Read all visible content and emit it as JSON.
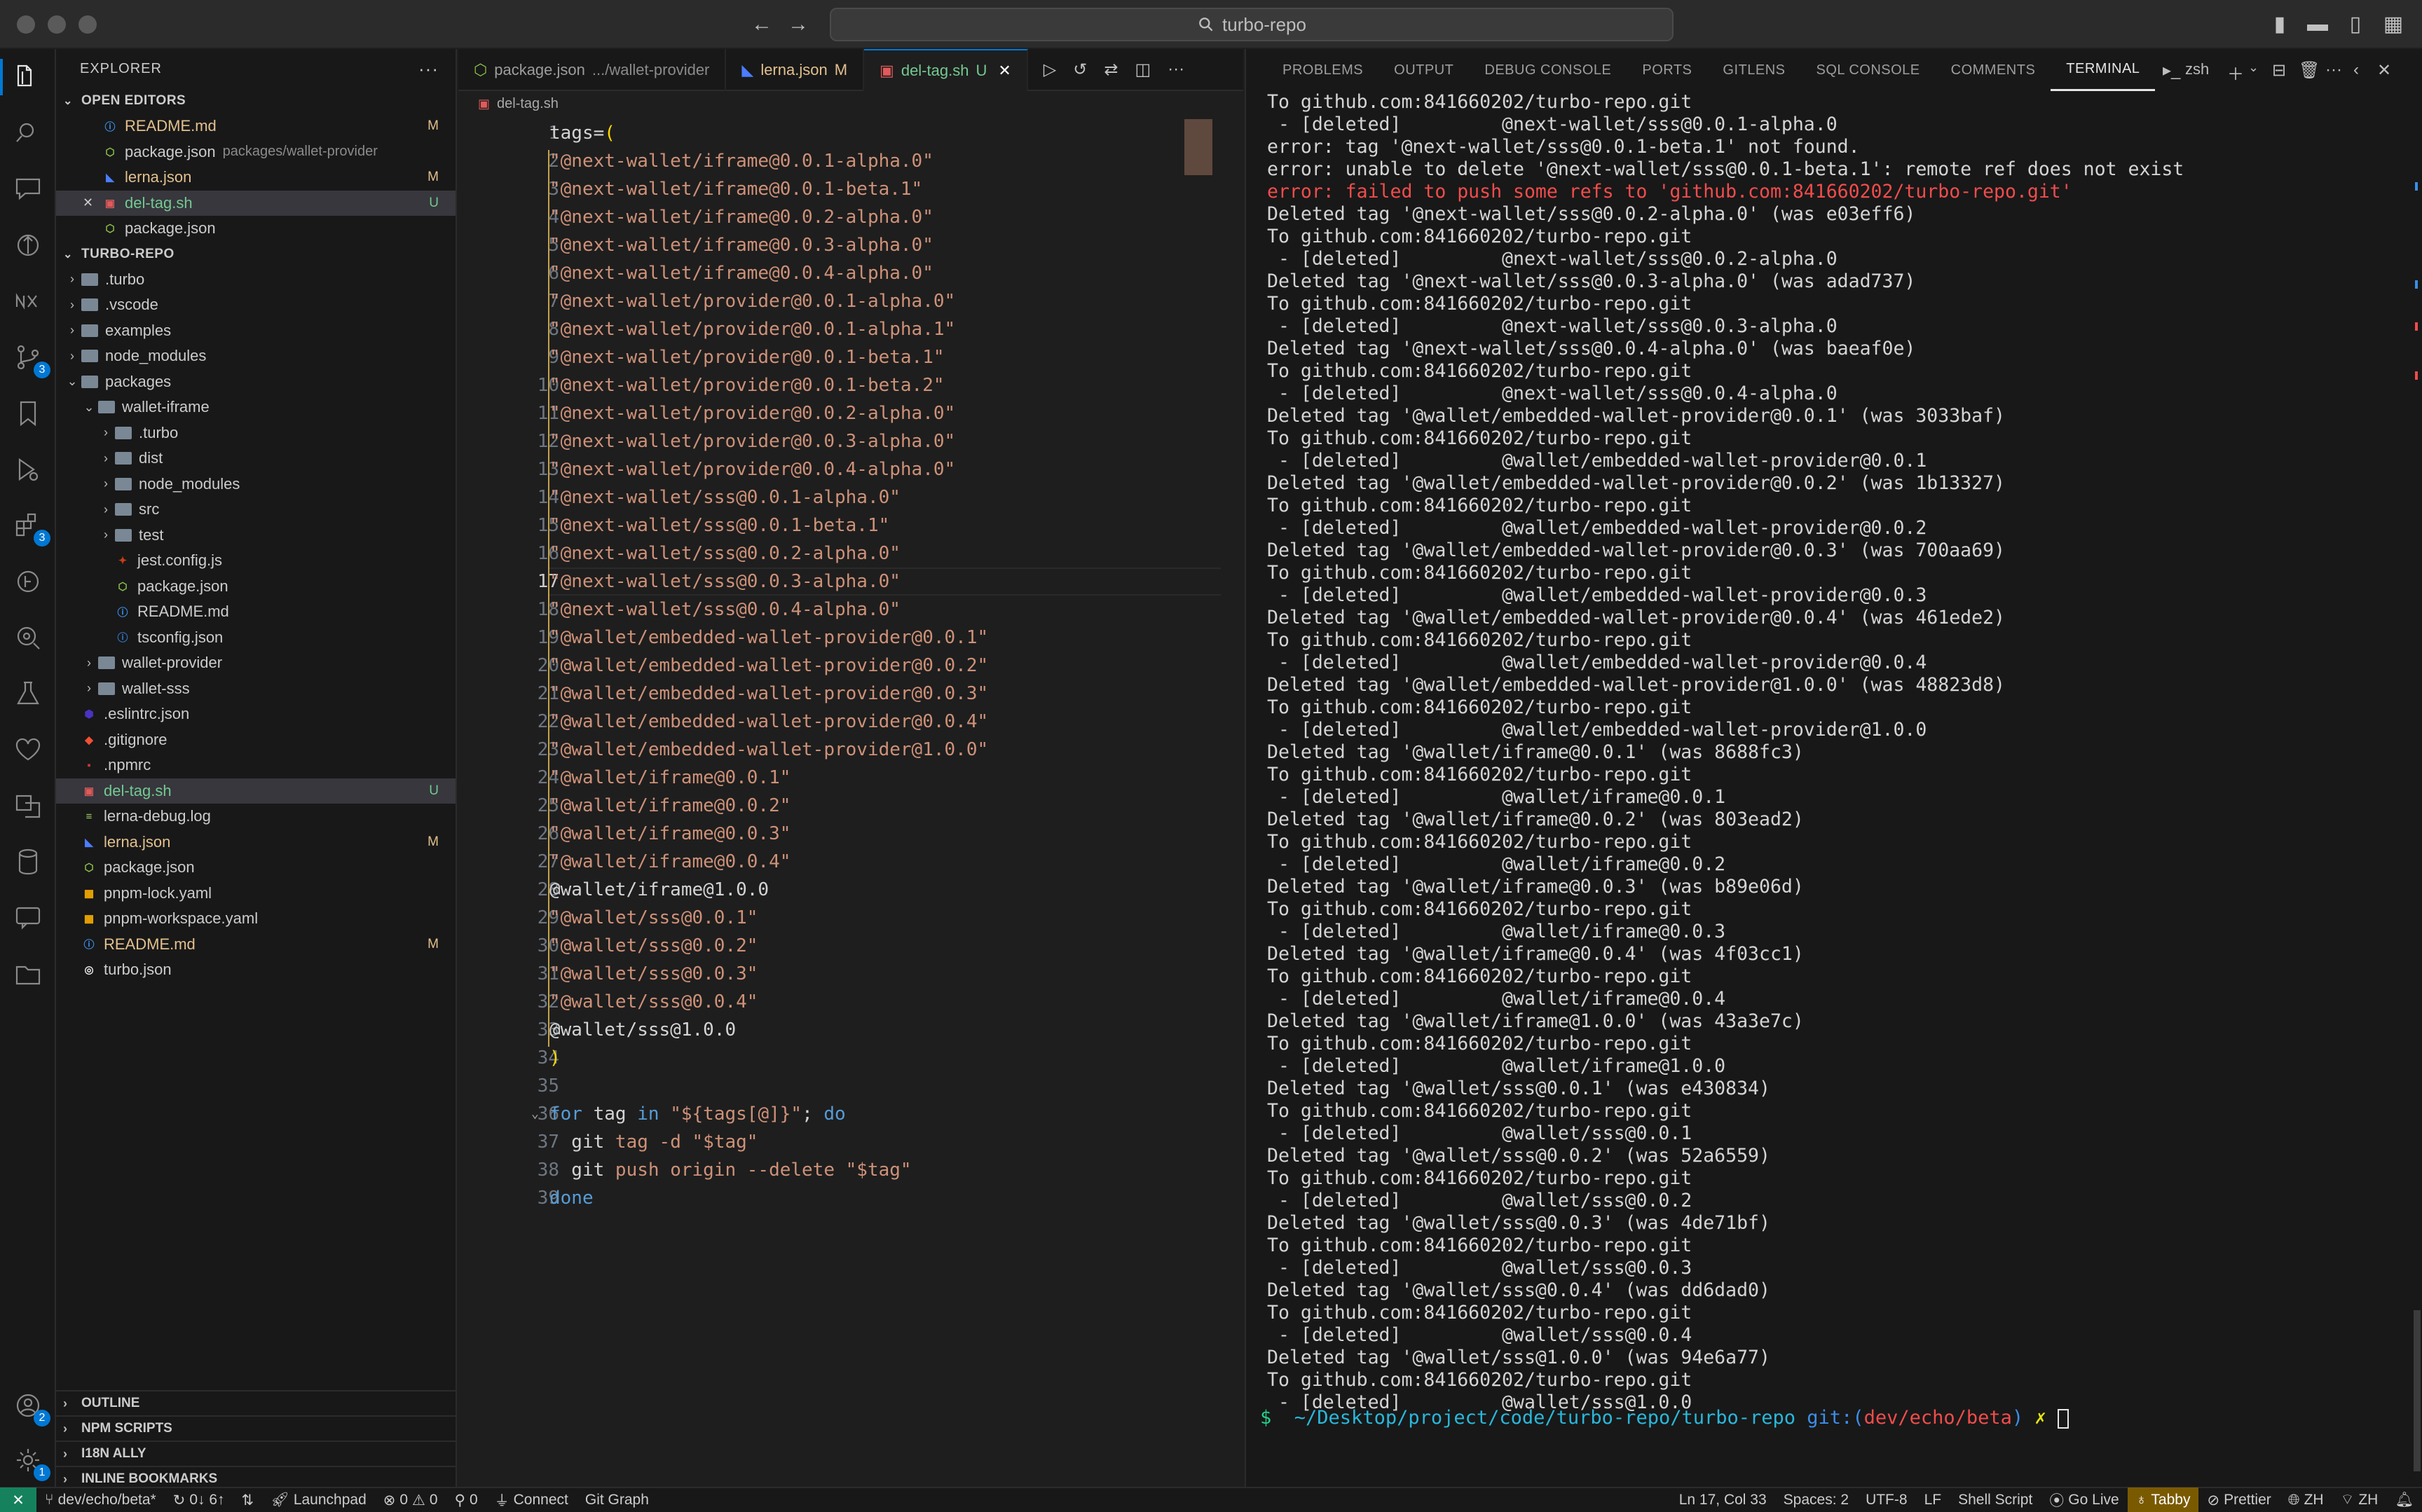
{
  "window": {
    "search_text": "turbo-repo"
  },
  "activity_bar": {
    "items": [
      {
        "name": "explorer"
      },
      {
        "name": "search"
      },
      {
        "name": "chat"
      },
      {
        "name": "gitlens"
      },
      {
        "name": "nx"
      },
      {
        "name": "source-control",
        "badge": "3"
      },
      {
        "name": "bookmarks"
      },
      {
        "name": "run-debug"
      },
      {
        "name": "extensions",
        "badge": "3"
      },
      {
        "name": "git-graph"
      },
      {
        "name": "remote"
      },
      {
        "name": "testing"
      },
      {
        "name": "favorites"
      },
      {
        "name": "i18n"
      },
      {
        "name": "database"
      },
      {
        "name": "comments"
      },
      {
        "name": "folder"
      }
    ],
    "accounts_badge": "2",
    "settings_badge": "1"
  },
  "sidebar": {
    "title": "EXPLORER",
    "open_editors_title": "OPEN EDITORS",
    "open_editors": [
      {
        "name": "README.md",
        "desc": "",
        "status": "M",
        "icon": "info"
      },
      {
        "name": "package.json",
        "desc": "packages/wallet-provider",
        "status": "",
        "icon": "json"
      },
      {
        "name": "lerna.json",
        "desc": "",
        "status": "M",
        "icon": "lerna"
      },
      {
        "name": "del-tag.sh",
        "desc": "",
        "status": "U",
        "icon": "shell"
      },
      {
        "name": "package.json",
        "desc": "",
        "status": "",
        "icon": "json"
      }
    ],
    "repo_title": "TURBO-REPO",
    "tree": [
      {
        "name": ".turbo",
        "type": "folder",
        "depth": 1,
        "open": false,
        "status": ""
      },
      {
        "name": ".vscode",
        "type": "folder",
        "depth": 1,
        "open": false,
        "status": ""
      },
      {
        "name": "examples",
        "type": "folder",
        "depth": 1,
        "open": false,
        "status": ""
      },
      {
        "name": "node_modules",
        "type": "folder",
        "depth": 1,
        "open": false,
        "status": ""
      },
      {
        "name": "packages",
        "type": "folder",
        "depth": 1,
        "open": true,
        "status": ""
      },
      {
        "name": "wallet-iframe",
        "type": "folder",
        "depth": 2,
        "open": true,
        "status": ""
      },
      {
        "name": ".turbo",
        "type": "folder",
        "depth": 3,
        "open": false,
        "status": ""
      },
      {
        "name": "dist",
        "type": "folder",
        "depth": 3,
        "open": false,
        "status": ""
      },
      {
        "name": "node_modules",
        "type": "folder",
        "depth": 3,
        "open": false,
        "status": ""
      },
      {
        "name": "src",
        "type": "folder",
        "depth": 3,
        "open": false,
        "status": ""
      },
      {
        "name": "test",
        "type": "folder",
        "depth": 3,
        "open": false,
        "status": ""
      },
      {
        "name": "jest.config.js",
        "type": "file",
        "depth": 3,
        "icon": "jest",
        "status": ""
      },
      {
        "name": "package.json",
        "type": "file",
        "depth": 3,
        "icon": "json",
        "status": ""
      },
      {
        "name": "README.md",
        "type": "file",
        "depth": 3,
        "icon": "info",
        "status": ""
      },
      {
        "name": "tsconfig.json",
        "type": "file",
        "depth": 3,
        "icon": "ts",
        "status": ""
      },
      {
        "name": "wallet-provider",
        "type": "folder",
        "depth": 2,
        "open": false,
        "status": ""
      },
      {
        "name": "wallet-sss",
        "type": "folder",
        "depth": 2,
        "open": false,
        "status": ""
      },
      {
        "name": ".eslintrc.json",
        "type": "file",
        "depth": 1,
        "icon": "eslint",
        "status": ""
      },
      {
        "name": ".gitignore",
        "type": "file",
        "depth": 1,
        "icon": "git",
        "status": ""
      },
      {
        "name": ".npmrc",
        "type": "file",
        "depth": 1,
        "icon": "npm",
        "status": ""
      },
      {
        "name": "del-tag.sh",
        "type": "file",
        "depth": 1,
        "icon": "shell",
        "status": "U",
        "selected": true
      },
      {
        "name": "lerna-debug.log",
        "type": "file",
        "depth": 1,
        "icon": "log",
        "status": ""
      },
      {
        "name": "lerna.json",
        "type": "file",
        "depth": 1,
        "icon": "lerna",
        "status": "M"
      },
      {
        "name": "package.json",
        "type": "file",
        "depth": 1,
        "icon": "json",
        "status": ""
      },
      {
        "name": "pnpm-lock.yaml",
        "type": "file",
        "depth": 1,
        "icon": "pnpm",
        "status": ""
      },
      {
        "name": "pnpm-workspace.yaml",
        "type": "file",
        "depth": 1,
        "icon": "pnpm",
        "status": ""
      },
      {
        "name": "README.md",
        "type": "file",
        "depth": 1,
        "icon": "info",
        "status": "M"
      },
      {
        "name": "turbo.json",
        "type": "file",
        "depth": 1,
        "icon": "turbo",
        "status": ""
      }
    ],
    "bottom_sections": [
      "OUTLINE",
      "NPM SCRIPTS",
      "I18N ALLY",
      "INLINE BOOKMARKS"
    ]
  },
  "editor": {
    "tabs": [
      {
        "label": "package.json",
        "desc": ".../wallet-provider",
        "status": "",
        "active": false,
        "icon": "json"
      },
      {
        "label": "lerna.json",
        "desc": "",
        "status": "M",
        "active": false,
        "icon": "lerna"
      },
      {
        "label": "del-tag.sh",
        "desc": "",
        "status": "U",
        "active": true,
        "icon": "shell"
      }
    ],
    "breadcrumb": "del-tag.sh",
    "current_line": 17,
    "lines": [
      "tags=(",
      "\"@next-wallet/iframe@0.0.1-alpha.0\"",
      "\"@next-wallet/iframe@0.0.1-beta.1\"",
      "\"@next-wallet/iframe@0.0.2-alpha.0\"",
      "\"@next-wallet/iframe@0.0.3-alpha.0\"",
      "\"@next-wallet/iframe@0.0.4-alpha.0\"",
      "\"@next-wallet/provider@0.0.1-alpha.0\"",
      "\"@next-wallet/provider@0.0.1-alpha.1\"",
      "\"@next-wallet/provider@0.0.1-beta.1\"",
      "\"@next-wallet/provider@0.0.1-beta.2\"",
      "\"@next-wallet/provider@0.0.2-alpha.0\"",
      "\"@next-wallet/provider@0.0.3-alpha.0\"",
      "\"@next-wallet/provider@0.0.4-alpha.0\"",
      "\"@next-wallet/sss@0.0.1-alpha.0\"",
      "\"@next-wallet/sss@0.0.1-beta.1\"",
      "\"@next-wallet/sss@0.0.2-alpha.0\"",
      "\"@next-wallet/sss@0.0.3-alpha.0\"",
      "\"@next-wallet/sss@0.0.4-alpha.0\"",
      "\"@wallet/embedded-wallet-provider@0.0.1\"",
      "\"@wallet/embedded-wallet-provider@0.0.2\"",
      "\"@wallet/embedded-wallet-provider@0.0.3\"",
      "\"@wallet/embedded-wallet-provider@0.0.4\"",
      "\"@wallet/embedded-wallet-provider@1.0.0\"",
      "\"@wallet/iframe@0.0.1\"",
      "\"@wallet/iframe@0.0.2\"",
      "\"@wallet/iframe@0.0.3\"",
      "\"@wallet/iframe@0.0.4\"",
      "@wallet/iframe@1.0.0",
      "\"@wallet/sss@0.0.1\"",
      "\"@wallet/sss@0.0.2\"",
      "\"@wallet/sss@0.0.3\"",
      "\"@wallet/sss@0.0.4\"",
      "@wallet/sss@1.0.0",
      ")",
      "",
      "for tag in \"${tags[@]}\"; do",
      "  git tag -d \"$tag\"",
      "  git push origin --delete \"$tag\"",
      "done"
    ]
  },
  "panel": {
    "tabs": [
      "PROBLEMS",
      "OUTPUT",
      "DEBUG CONSOLE",
      "PORTS",
      "GITLENS",
      "SQL CONSOLE",
      "COMMENTS",
      "TERMINAL"
    ],
    "active_tab": "TERMINAL",
    "shell_label": "zsh",
    "terminal_lines": [
      {
        "t": "To github.com:841660202/turbo-repo.git",
        "err": false
      },
      {
        "t": " - [deleted]         @next-wallet/sss@0.0.1-alpha.0",
        "err": false
      },
      {
        "t": "error: tag '@next-wallet/sss@0.0.1-beta.1' not found.",
        "err": false
      },
      {
        "t": "error: unable to delete '@next-wallet/sss@0.0.1-beta.1': remote ref does not exist",
        "err": false
      },
      {
        "t": "error: failed to push some refs to 'github.com:841660202/turbo-repo.git'",
        "err": true
      },
      {
        "t": "Deleted tag '@next-wallet/sss@0.0.2-alpha.0' (was e03eff6)",
        "err": false
      },
      {
        "t": "To github.com:841660202/turbo-repo.git",
        "err": false
      },
      {
        "t": " - [deleted]         @next-wallet/sss@0.0.2-alpha.0",
        "err": false
      },
      {
        "t": "Deleted tag '@next-wallet/sss@0.0.3-alpha.0' (was adad737)",
        "err": false
      },
      {
        "t": "To github.com:841660202/turbo-repo.git",
        "err": false
      },
      {
        "t": " - [deleted]         @next-wallet/sss@0.0.3-alpha.0",
        "err": false
      },
      {
        "t": "Deleted tag '@next-wallet/sss@0.0.4-alpha.0' (was baeaf0e)",
        "err": false
      },
      {
        "t": "To github.com:841660202/turbo-repo.git",
        "err": false
      },
      {
        "t": " - [deleted]         @next-wallet/sss@0.0.4-alpha.0",
        "err": false
      },
      {
        "t": "Deleted tag '@wallet/embedded-wallet-provider@0.0.1' (was 3033baf)",
        "err": false
      },
      {
        "t": "To github.com:841660202/turbo-repo.git",
        "err": false
      },
      {
        "t": " - [deleted]         @wallet/embedded-wallet-provider@0.0.1",
        "err": false
      },
      {
        "t": "Deleted tag '@wallet/embedded-wallet-provider@0.0.2' (was 1b13327)",
        "err": false
      },
      {
        "t": "To github.com:841660202/turbo-repo.git",
        "err": false
      },
      {
        "t": " - [deleted]         @wallet/embedded-wallet-provider@0.0.2",
        "err": false
      },
      {
        "t": "Deleted tag '@wallet/embedded-wallet-provider@0.0.3' (was 700aa69)",
        "err": false
      },
      {
        "t": "To github.com:841660202/turbo-repo.git",
        "err": false
      },
      {
        "t": " - [deleted]         @wallet/embedded-wallet-provider@0.0.3",
        "err": false
      },
      {
        "t": "Deleted tag '@wallet/embedded-wallet-provider@0.0.4' (was 461ede2)",
        "err": false
      },
      {
        "t": "To github.com:841660202/turbo-repo.git",
        "err": false
      },
      {
        "t": " - [deleted]         @wallet/embedded-wallet-provider@0.0.4",
        "err": false
      },
      {
        "t": "Deleted tag '@wallet/embedded-wallet-provider@1.0.0' (was 48823d8)",
        "err": false
      },
      {
        "t": "To github.com:841660202/turbo-repo.git",
        "err": false
      },
      {
        "t": " - [deleted]         @wallet/embedded-wallet-provider@1.0.0",
        "err": false
      },
      {
        "t": "Deleted tag '@wallet/iframe@0.0.1' (was 8688fc3)",
        "err": false
      },
      {
        "t": "To github.com:841660202/turbo-repo.git",
        "err": false
      },
      {
        "t": " - [deleted]         @wallet/iframe@0.0.1",
        "err": false
      },
      {
        "t": "Deleted tag '@wallet/iframe@0.0.2' (was 803ead2)",
        "err": false
      },
      {
        "t": "To github.com:841660202/turbo-repo.git",
        "err": false
      },
      {
        "t": " - [deleted]         @wallet/iframe@0.0.2",
        "err": false
      },
      {
        "t": "Deleted tag '@wallet/iframe@0.0.3' (was b89e06d)",
        "err": false
      },
      {
        "t": "To github.com:841660202/turbo-repo.git",
        "err": false
      },
      {
        "t": " - [deleted]         @wallet/iframe@0.0.3",
        "err": false
      },
      {
        "t": "Deleted tag '@wallet/iframe@0.0.4' (was 4f03cc1)",
        "err": false
      },
      {
        "t": "To github.com:841660202/turbo-repo.git",
        "err": false
      },
      {
        "t": " - [deleted]         @wallet/iframe@0.0.4",
        "err": false
      },
      {
        "t": "Deleted tag '@wallet/iframe@1.0.0' (was 43a3e7c)",
        "err": false
      },
      {
        "t": "To github.com:841660202/turbo-repo.git",
        "err": false
      },
      {
        "t": " - [deleted]         @wallet/iframe@1.0.0",
        "err": false
      },
      {
        "t": "Deleted tag '@wallet/sss@0.0.1' (was e430834)",
        "err": false
      },
      {
        "t": "To github.com:841660202/turbo-repo.git",
        "err": false
      },
      {
        "t": " - [deleted]         @wallet/sss@0.0.1",
        "err": false
      },
      {
        "t": "Deleted tag '@wallet/sss@0.0.2' (was 52a6559)",
        "err": false
      },
      {
        "t": "To github.com:841660202/turbo-repo.git",
        "err": false
      },
      {
        "t": " - [deleted]         @wallet/sss@0.0.2",
        "err": false
      },
      {
        "t": "Deleted tag '@wallet/sss@0.0.3' (was 4de71bf)",
        "err": false
      },
      {
        "t": "To github.com:841660202/turbo-repo.git",
        "err": false
      },
      {
        "t": " - [deleted]         @wallet/sss@0.0.3",
        "err": false
      },
      {
        "t": "Deleted tag '@wallet/sss@0.0.4' (was dd6dad0)",
        "err": false
      },
      {
        "t": "To github.com:841660202/turbo-repo.git",
        "err": false
      },
      {
        "t": " - [deleted]         @wallet/sss@0.0.4",
        "err": false
      },
      {
        "t": "Deleted tag '@wallet/sss@1.0.0' (was 94e6a77)",
        "err": false
      },
      {
        "t": "To github.com:841660202/turbo-repo.git",
        "err": false
      },
      {
        "t": " - [deleted]         @wallet/sss@1.0.0",
        "err": false
      }
    ],
    "prompt": {
      "symbol": "$",
      "path": "~/Desktop/project/code/turbo-repo/turbo-repo",
      "git_prefix": "git:(",
      "branch": "dev/echo/beta",
      "git_suffix": ")",
      "dirty": "✗"
    }
  },
  "statusbar": {
    "branch": "dev/echo/beta*",
    "sync": "0↓ 6↑",
    "launchpad": "Launchpad",
    "errors": "0",
    "warnings": "0",
    "ports": "0",
    "connect": "Connect",
    "git_graph": "Git Graph",
    "position": "Ln 17, Col 33",
    "spaces": "Spaces: 2",
    "encoding": "UTF-8",
    "eol": "LF",
    "language": "Shell Script",
    "golive": "Go Live",
    "tabby": "Tabby",
    "prettier": "Prettier",
    "locale": "ZH",
    "locale2": "ZH"
  },
  "colors": {
    "accent": "#0078d4",
    "string": "#ce9178",
    "keyword": "#569cd6",
    "error": "#f14c4c",
    "modified": "#e2c08d",
    "untracked": "#73c991"
  }
}
